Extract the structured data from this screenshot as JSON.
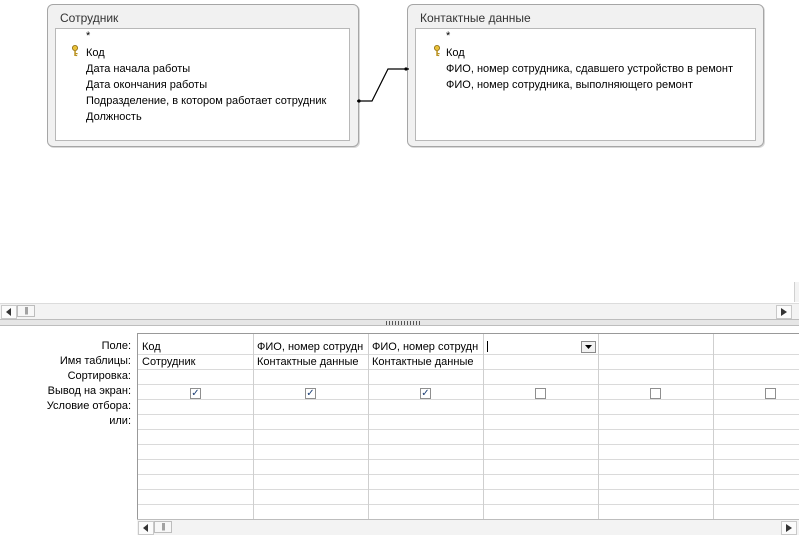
{
  "tables": [
    {
      "title": "Сотрудник",
      "fields": [
        "*",
        "Код",
        "Дата начала работы",
        "Дата окончания работы",
        "Подразделение, в котором работает сотрудник",
        "Должность"
      ]
    },
    {
      "title": "Контактные данные",
      "fields": [
        "*",
        "Код",
        "ФИО, номер сотрудника, сдавшего устройство в ремонт",
        "ФИО, номер сотрудника, выполняющего ремонт"
      ]
    }
  ],
  "grid": {
    "row_labels": [
      "Поле:",
      "Имя таблицы:",
      "Сортировка:",
      "Вывод на экран:",
      "Условие отбора:",
      "или:"
    ],
    "columns": [
      {
        "field": "Код",
        "table": "Сотрудник",
        "show": true
      },
      {
        "field": "ФИО, номер сотрудн",
        "table": "Контактные данные",
        "show": true
      },
      {
        "field": "ФИО, номер сотрудн",
        "table": "Контактные данные",
        "show": true
      },
      {
        "field": "",
        "table": "",
        "show": false
      },
      {
        "field": "",
        "table": "",
        "show": false
      },
      {
        "field": "",
        "table": "",
        "show": false
      }
    ]
  },
  "icons": {
    "key": "key-icon",
    "scroll_left": "arrow-left-icon",
    "scroll_right": "arrow-right-icon",
    "dropdown": "chevron-down-icon",
    "checkmark": "✓"
  },
  "colors": {
    "pane_border": "#a6a6a6",
    "pane_bg": "#f1f1f1",
    "check": "#1c3f75"
  }
}
